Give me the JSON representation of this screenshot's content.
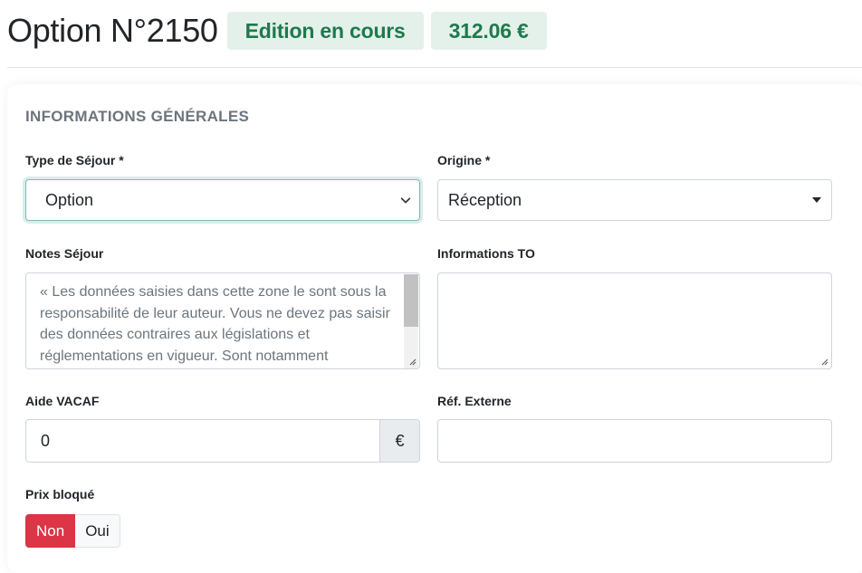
{
  "header": {
    "title": "Option N°2150",
    "status_badge": "Edition en cours",
    "amount_badge": "312.06 €"
  },
  "section": {
    "title": "INFORMATIONS GÉNÉRALES"
  },
  "form": {
    "type_sejour": {
      "label": "Type de Séjour *",
      "value": "Option"
    },
    "origine": {
      "label": "Origine *",
      "value": "Réception"
    },
    "notes_sejour": {
      "label": "Notes Séjour",
      "placeholder": "« Les données saisies dans cette zone le sont sous la responsabilité de leur auteur. Vous ne devez pas saisir des données contraires aux législations et réglementations en vigueur. Sont notamment"
    },
    "informations_to": {
      "label": "Informations TO",
      "value": ""
    },
    "aide_vacaf": {
      "label": "Aide VACAF",
      "value": "0",
      "addon": "€"
    },
    "ref_externe": {
      "label": "Réf. Externe",
      "value": ""
    },
    "prix_bloque": {
      "label": "Prix bloqué",
      "options": [
        "Non",
        "Oui"
      ],
      "selected": "Non"
    }
  },
  "colors": {
    "badge_bg": "#e4f1ea",
    "badge_text": "#1e7a4d",
    "toggle_active": "#dc3545"
  }
}
